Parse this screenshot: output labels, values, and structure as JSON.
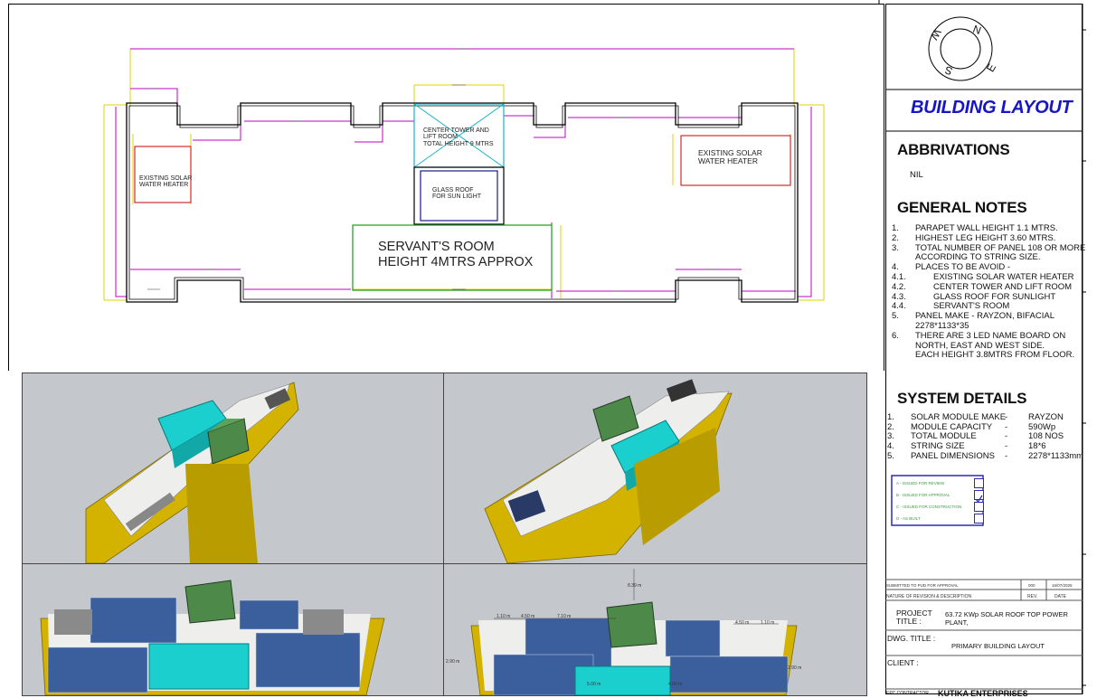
{
  "plan": {
    "labels": {
      "center_tower": "CENTER TOWER AND\nLIFT ROOM\nTOTAL HEIGHT 9 MTRS",
      "glass_roof": "GLASS ROOF\nFOR SUN LIGHT",
      "servant_room": "SERVANT'S ROOM\nHEIGHT 4MTRS APPROX",
      "heater_left": "EXISTING SOLAR\nWATER HEATER",
      "heater_right": "EXISTING SOLAR\nWATER HEATER"
    },
    "colors": {
      "outline": "#000000",
      "setback": "#c000c0",
      "dimension": "#e0d000",
      "heater": "#cc0000",
      "tower": "#19b5c4",
      "glass": "#1a1a8c",
      "servant": "#1a9a1a"
    }
  },
  "views": {
    "bottom_right_dims": [
      "8.39 m",
      "1.10 m",
      "4.50 m",
      "7.10 m",
      "4.50 m",
      "1.10 m",
      "2.90 m",
      "2.90 m",
      "5.00 m",
      "4.00 m"
    ],
    "colors": {
      "bg": "#c4c7cb",
      "wall": "#d3b200",
      "floor": "#eeeeec",
      "tank": "#1ccfcf",
      "tower": "#4d8a4a",
      "panel": "#3b5f9c"
    }
  },
  "title_block": {
    "compass": [
      "N",
      "E",
      "S",
      "W"
    ],
    "title": "BUILDING LAYOUT",
    "abbr_heading": "ABBRIVATIONS",
    "abbr_value": "NIL",
    "notes_heading": "GENERAL NOTES",
    "notes": [
      {
        "n": "1.",
        "t": "PARAPET WALL HEIGHT 1.1 MTRS."
      },
      {
        "n": "2.",
        "t": "HIGHEST LEG HEIGHT 3.60 MTRS."
      },
      {
        "n": "3.",
        "t": "TOTAL NUMBER OF PANEL 108 OR MORE"
      },
      {
        "n": "",
        "t": "ACCORDING TO STRING SIZE."
      },
      {
        "n": "4.",
        "t": "PLACES TO BE AVOID -"
      },
      {
        "n": "4.1.",
        "t": "EXISTING SOLAR WATER HEATER"
      },
      {
        "n": "4.2.",
        "t": "CENTER TOWER AND LIFT ROOM"
      },
      {
        "n": "4.3.",
        "t": "GLASS ROOF FOR SUNLIGHT"
      },
      {
        "n": "4.4.",
        "t": "SERVANT'S ROOM"
      },
      {
        "n": "5.",
        "t": "PANEL MAKE - RAYZON, BIFACIAL"
      },
      {
        "n": "",
        "t": "2278*1133*35"
      },
      {
        "n": "6.",
        "t": "THERE ARE 3 LED NAME BOARD ON"
      },
      {
        "n": "",
        "t": "NORTH, EAST AND WEST SIDE."
      },
      {
        "n": "",
        "t": "EACH HEIGHT 3.8MTRS FROM FLOOR."
      }
    ],
    "system_heading": "SYSTEM DETAILS",
    "system": [
      {
        "n": "1.",
        "k": "SOLAR MODULE MAKE",
        "v": "RAYZON"
      },
      {
        "n": "2.",
        "k": "MODULE CAPACITY",
        "v": "590Wp"
      },
      {
        "n": "3.",
        "k": "TOTAL MODULE",
        "v": "108 NOS"
      },
      {
        "n": "4.",
        "k": "STRING SIZE",
        "v": "18*6"
      },
      {
        "n": "5.",
        "k": "PANEL DIMENSIONS",
        "v": "2278*1133mm"
      }
    ],
    "system_dash": "-",
    "approval": [
      {
        "label": "A - ISSUED FOR REVIEW",
        "checked": false
      },
      {
        "label": "B - ISSUED FOR APPROVAL",
        "checked": true
      },
      {
        "label": "C - ISSUED FOR CONSTRUCTION",
        "checked": false
      },
      {
        "label": "D - AS BUILT",
        "checked": false
      }
    ],
    "revision": {
      "desc": "SUBMITTED TO PUD FOR APPROVAL",
      "rev": "000",
      "date": "16/07/2025"
    },
    "revision_header": {
      "desc": "NATURE OF REVISION & DESCRIPTION",
      "rev": "REV.",
      "date": "DATE"
    },
    "project_label": "PROJECT\nTITLE :",
    "project_value": "63.72 KWp SOLAR ROOF TOP POWER\nPLANT,",
    "dwg_label": "DWG. TITLE :",
    "dwg_value": "PRIMARY BUILDING LAYOUT",
    "client_label": "CLIENT :",
    "contractor_label": "EPC CONTRACTOR",
    "contractor_value": "KUTIKA ENTERPRISES"
  }
}
